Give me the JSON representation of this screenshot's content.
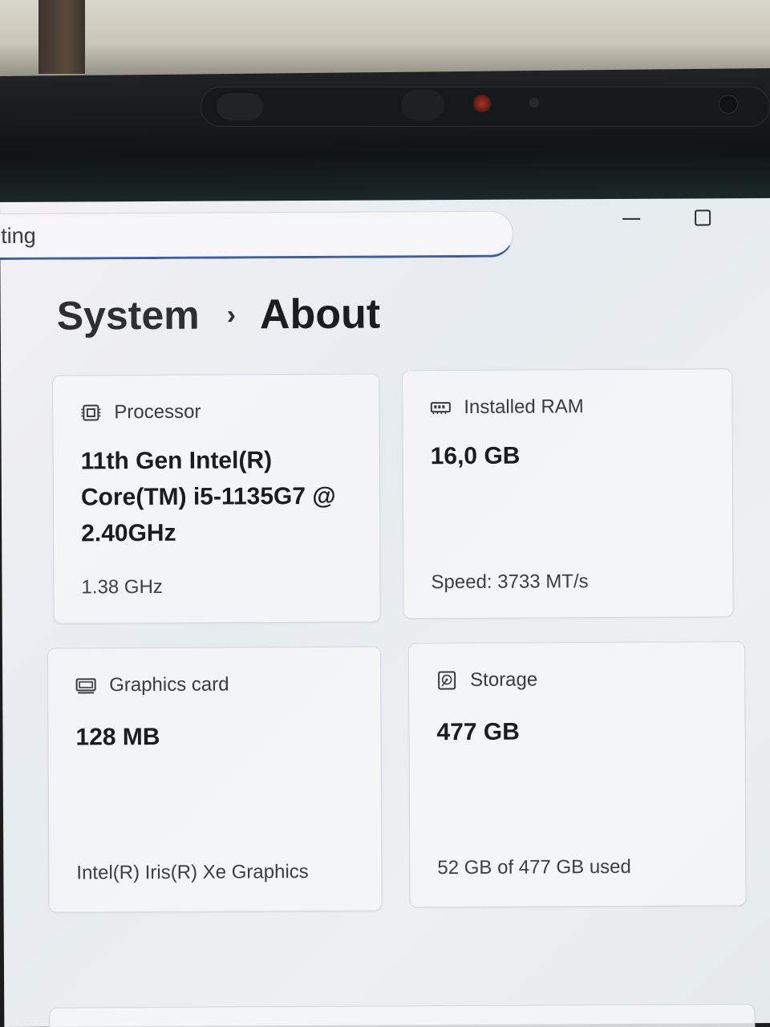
{
  "search": {
    "value": "ting"
  },
  "window_controls": {
    "minimize_icon": "minimize-icon",
    "maximize_icon": "maximize-icon"
  },
  "breadcrumb": {
    "parent": "System",
    "separator": "›",
    "current": "About"
  },
  "cards": {
    "processor": {
      "label": "Processor",
      "icon": "processor-chip-icon",
      "value": "11th Gen Intel(R) Core(TM) i5-1135G7 @ 2.40GHz",
      "sub": "1.38 GHz"
    },
    "ram": {
      "label": "Installed RAM",
      "icon": "ram-module-icon",
      "value": "16,0 GB",
      "sub": "Speed: 3733 MT/s"
    },
    "gpu": {
      "label": "Graphics card",
      "icon": "graphics-card-icon",
      "value": "128 MB",
      "sub": "Intel(R) Iris(R) Xe Graphics"
    },
    "storage": {
      "label": "Storage",
      "icon": "storage-drive-icon",
      "value": "477 GB",
      "sub": "52 GB of 477 GB used"
    }
  },
  "colors": {
    "accent": "#3d5fa0",
    "text_primary": "#1b1c1f",
    "text_secondary": "#3d3e42",
    "card_border": "#d4d8dd",
    "bezel": "#111416"
  }
}
